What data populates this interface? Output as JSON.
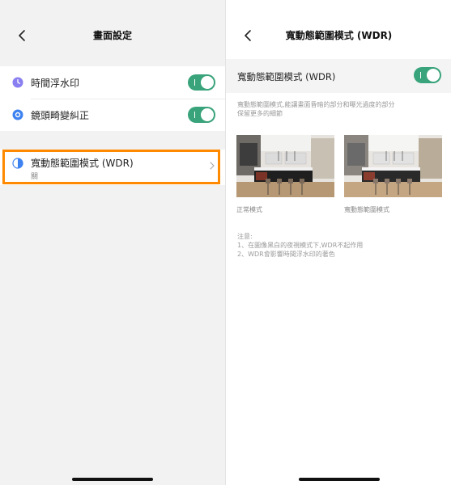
{
  "left": {
    "title": "畫面設定",
    "items": [
      {
        "label": "時間浮水印",
        "icon": "clock-icon",
        "enabled": true
      },
      {
        "label": "鏡頭畸變糾正",
        "icon": "lens-icon",
        "enabled": true
      }
    ],
    "wdr": {
      "label": "寬動態範圍模式 (WDR)",
      "sub": "關",
      "icon": "contrast-icon"
    }
  },
  "right": {
    "title": "寬動態範圍模式 (WDR)",
    "toggle_label": "寬動態範圍模式 (WDR)",
    "toggle_on": true,
    "desc_line1": "寬動態範圍模式,能讓畫面昏暗的部分和曝光過度的部分",
    "desc_line2": "保留更多的細節",
    "caption_normal": "正常模式",
    "caption_wdr": "寬動態範圍模式",
    "notes": [
      "注意:",
      "1、在圖像黑白的夜視模式下,WDR不起作用",
      "2、WDR會影響時間浮水印的著色"
    ]
  },
  "colors": {
    "toggle": "#39a37b",
    "highlight": "#ff8a00",
    "icon_purple": "#8a7ff0",
    "icon_blue": "#3d82f0"
  }
}
